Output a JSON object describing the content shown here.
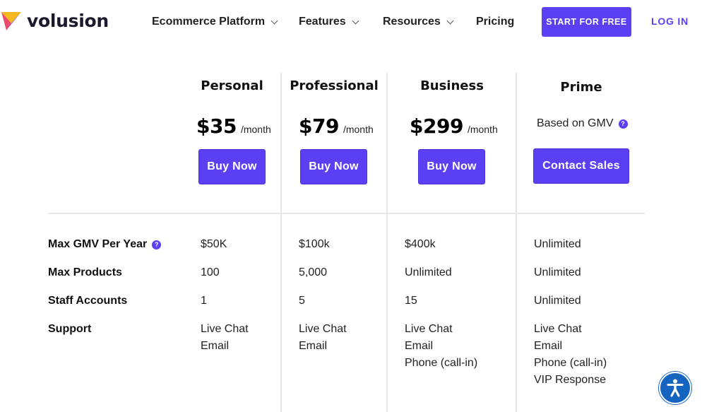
{
  "header": {
    "brand": "volusion",
    "nav": [
      {
        "label": "Ecommerce Platform",
        "has_dropdown": true
      },
      {
        "label": "Features",
        "has_dropdown": true
      },
      {
        "label": "Resources",
        "has_dropdown": true
      },
      {
        "label": "Pricing",
        "has_dropdown": false
      }
    ],
    "cta_label": "START FOR FREE",
    "login_label": "LOG IN"
  },
  "plans": [
    {
      "name": "Personal",
      "price": "$35",
      "period": "/month",
      "button": "Buy Now"
    },
    {
      "name": "Professional",
      "price": "$79",
      "period": "/month",
      "button": "Buy Now"
    },
    {
      "name": "Business",
      "price": "$299",
      "period": "/month",
      "button": "Buy Now"
    },
    {
      "name": "Prime",
      "price_note": "Based on GMV",
      "button": "Contact Sales"
    }
  ],
  "help_glyph": "?",
  "features": [
    {
      "label": "Max GMV Per Year",
      "has_help": true,
      "values": [
        [
          "$50K"
        ],
        [
          "$100k"
        ],
        [
          "$400k"
        ],
        [
          "Unlimited"
        ]
      ]
    },
    {
      "label": "Max Products",
      "has_help": false,
      "values": [
        [
          "100"
        ],
        [
          "5,000"
        ],
        [
          "Unlimited"
        ],
        [
          "Unlimited"
        ]
      ]
    },
    {
      "label": "Staff Accounts",
      "has_help": false,
      "values": [
        [
          "1"
        ],
        [
          "5"
        ],
        [
          "15"
        ],
        [
          "Unlimited"
        ]
      ]
    },
    {
      "label": "Support",
      "has_help": false,
      "values": [
        [
          "Live Chat",
          "Email"
        ],
        [
          "Live Chat",
          "Email"
        ],
        [
          "Live Chat",
          "Email",
          "Phone (call-in)"
        ],
        [
          "Live Chat",
          "Email",
          "Phone (call-in)",
          "VIP Response"
        ]
      ]
    }
  ],
  "colors": {
    "accent": "#5b3ff2",
    "accessibility": "#1565c0",
    "divider": "#e6e6e6"
  },
  "icons": {
    "logo": "volusion-logo-icon",
    "dropdown": "chevron-down-icon",
    "help": "question-circle-icon",
    "accessibility": "accessibility-icon"
  }
}
